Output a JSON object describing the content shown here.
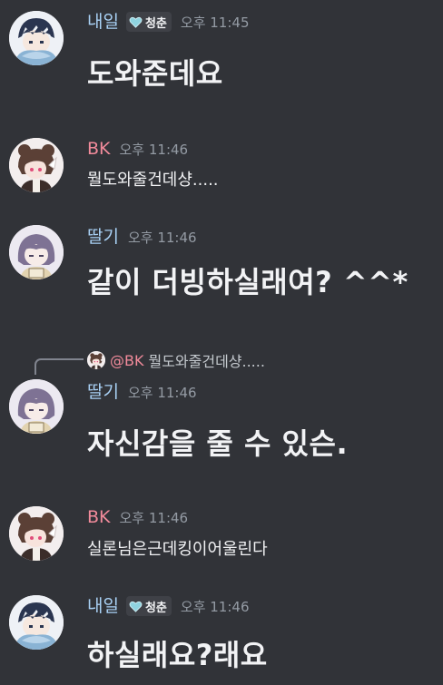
{
  "colors": {
    "background": "#313338",
    "naeil_name": "#a9d1f5",
    "bk_name": "#f28b9b",
    "ttalgi_name": "#a9d1f5",
    "timestamp": "#949ba4"
  },
  "messages": [
    {
      "author": "내일",
      "tag": "청춘",
      "tag_icon": "heart-icon",
      "time": "오후 11:45",
      "text": "도와준데요"
    },
    {
      "author": "BK",
      "time": "오후 11:46",
      "text": "뭘도와줄건데샹....."
    },
    {
      "author": "딸기",
      "time": "오후 11:46",
      "text": "같이 더빙하실래여? ^^*"
    },
    {
      "author": "딸기",
      "time": "오후 11:46",
      "text": "자신감을 줄 수 있슨.",
      "reply": {
        "mention": "@BK",
        "preview": "뭘도와줄건데샹....."
      }
    },
    {
      "author": "BK",
      "time": "오후 11:46",
      "text": "실론님은근데킹이어울린다"
    },
    {
      "author": "내일",
      "tag": "청춘",
      "tag_icon": "heart-icon",
      "time": "오후 11:46",
      "text": "하실래요?래요"
    }
  ]
}
